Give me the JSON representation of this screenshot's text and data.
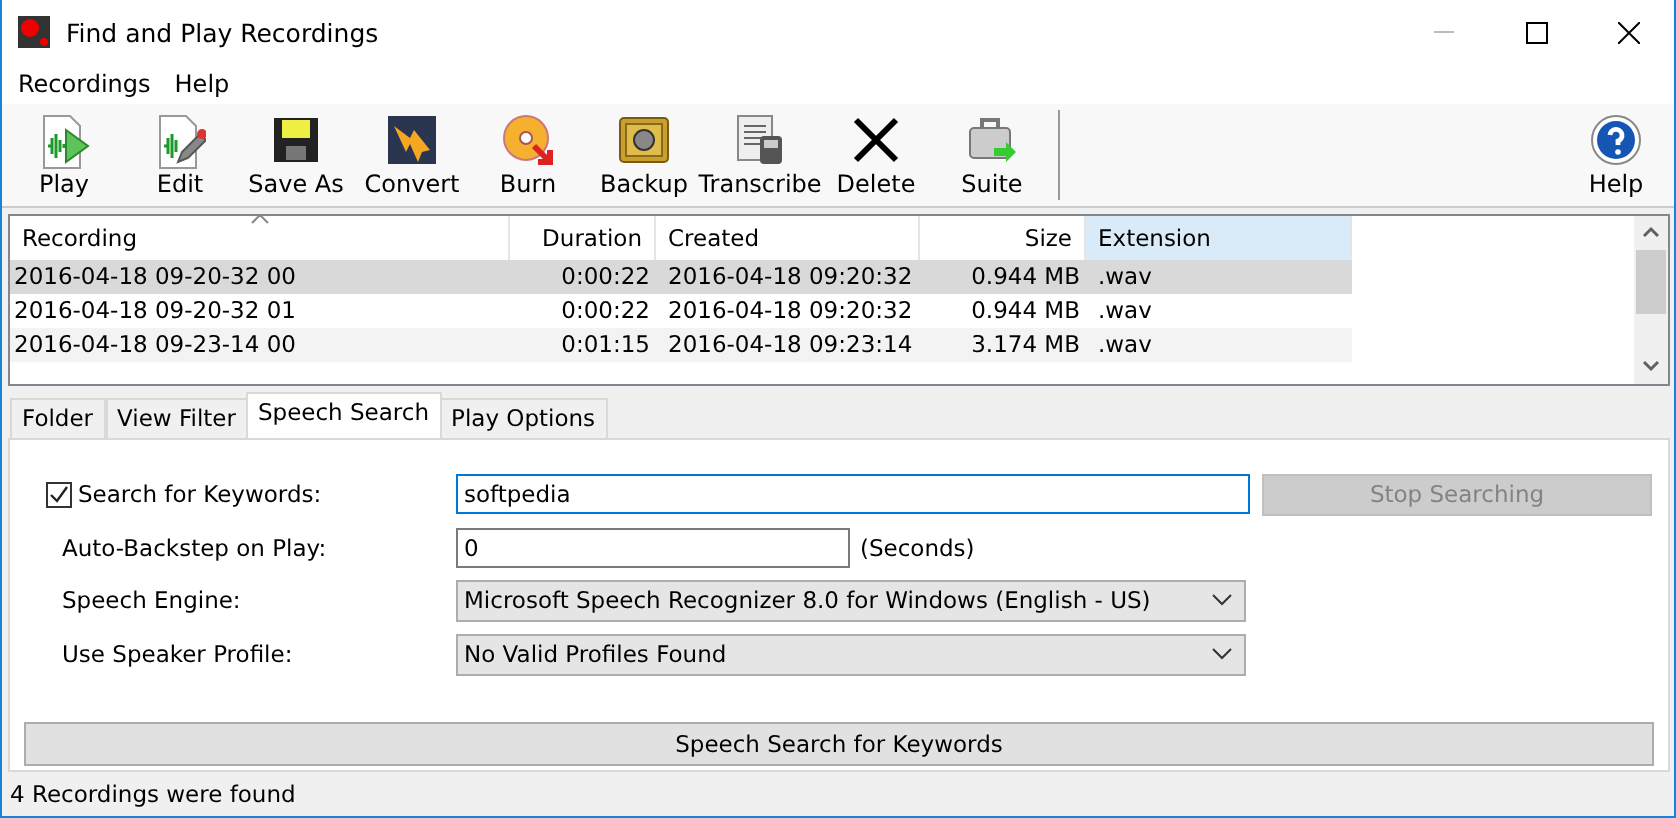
{
  "window": {
    "title": "Find and Play Recordings"
  },
  "menu": [
    "Recordings",
    "Help"
  ],
  "toolbar": {
    "buttons": [
      {
        "kind": "play",
        "label": "Play"
      },
      {
        "kind": "edit",
        "label": "Edit"
      },
      {
        "kind": "save",
        "label": "Save As"
      },
      {
        "kind": "convert",
        "label": "Convert"
      },
      {
        "kind": "burn",
        "label": "Burn"
      },
      {
        "kind": "backup",
        "label": "Backup"
      },
      {
        "kind": "transcribe",
        "label": "Transcribe"
      },
      {
        "kind": "delete",
        "label": "Delete"
      },
      {
        "kind": "suite",
        "label": "Suite"
      }
    ],
    "right_buttons": [
      {
        "kind": "help",
        "label": "Help"
      }
    ]
  },
  "table": {
    "columns": [
      {
        "label": "Recording",
        "sorted": true,
        "hot": false
      },
      {
        "label": "Duration",
        "sorted": false,
        "hot": false
      },
      {
        "label": "Created",
        "sorted": false,
        "hot": false
      },
      {
        "label": "Size",
        "sorted": false,
        "hot": false
      },
      {
        "label": "Extension",
        "sorted": false,
        "hot": true
      }
    ],
    "rows": [
      {
        "cells": [
          "2016-04-18 09-20-32 00",
          "0:00:22",
          "2016-04-18 09:20:32",
          "0.944 MB",
          ".wav"
        ],
        "selected": true
      },
      {
        "cells": [
          "2016-04-18 09-20-32 01",
          "0:00:22",
          "2016-04-18 09:20:32",
          "0.944 MB",
          ".wav"
        ],
        "selected": false
      },
      {
        "cells": [
          "2016-04-18 09-23-14 00",
          "0:01:15",
          "2016-04-18 09:23:14",
          "3.174 MB",
          ".wav"
        ],
        "selected": false
      }
    ]
  },
  "tabs": [
    {
      "label": "Folder",
      "selected": false
    },
    {
      "label": "View Filter",
      "selected": false
    },
    {
      "label": "Speech Search",
      "selected": true
    },
    {
      "label": "Play Options",
      "selected": false
    }
  ],
  "speech_search": {
    "keywords": {
      "label": "Search for Keywords:",
      "checked": true,
      "value": "softpedia",
      "focused": true
    },
    "stop_button": {
      "label": "Stop Searching",
      "disabled": true
    },
    "backstep": {
      "label": "Auto-Backstep on Play:",
      "value": "0",
      "unit": "(Seconds)"
    },
    "engine": {
      "label": "Speech Engine:",
      "value": "Microsoft Speech Recognizer 8.0 for Windows (English - US)"
    },
    "profile": {
      "label": "Use Speaker Profile:",
      "value": "No Valid Profiles Found"
    },
    "search_button": {
      "label": "Speech Search for Keywords"
    }
  },
  "status_bar": "4 Recordings were found"
}
